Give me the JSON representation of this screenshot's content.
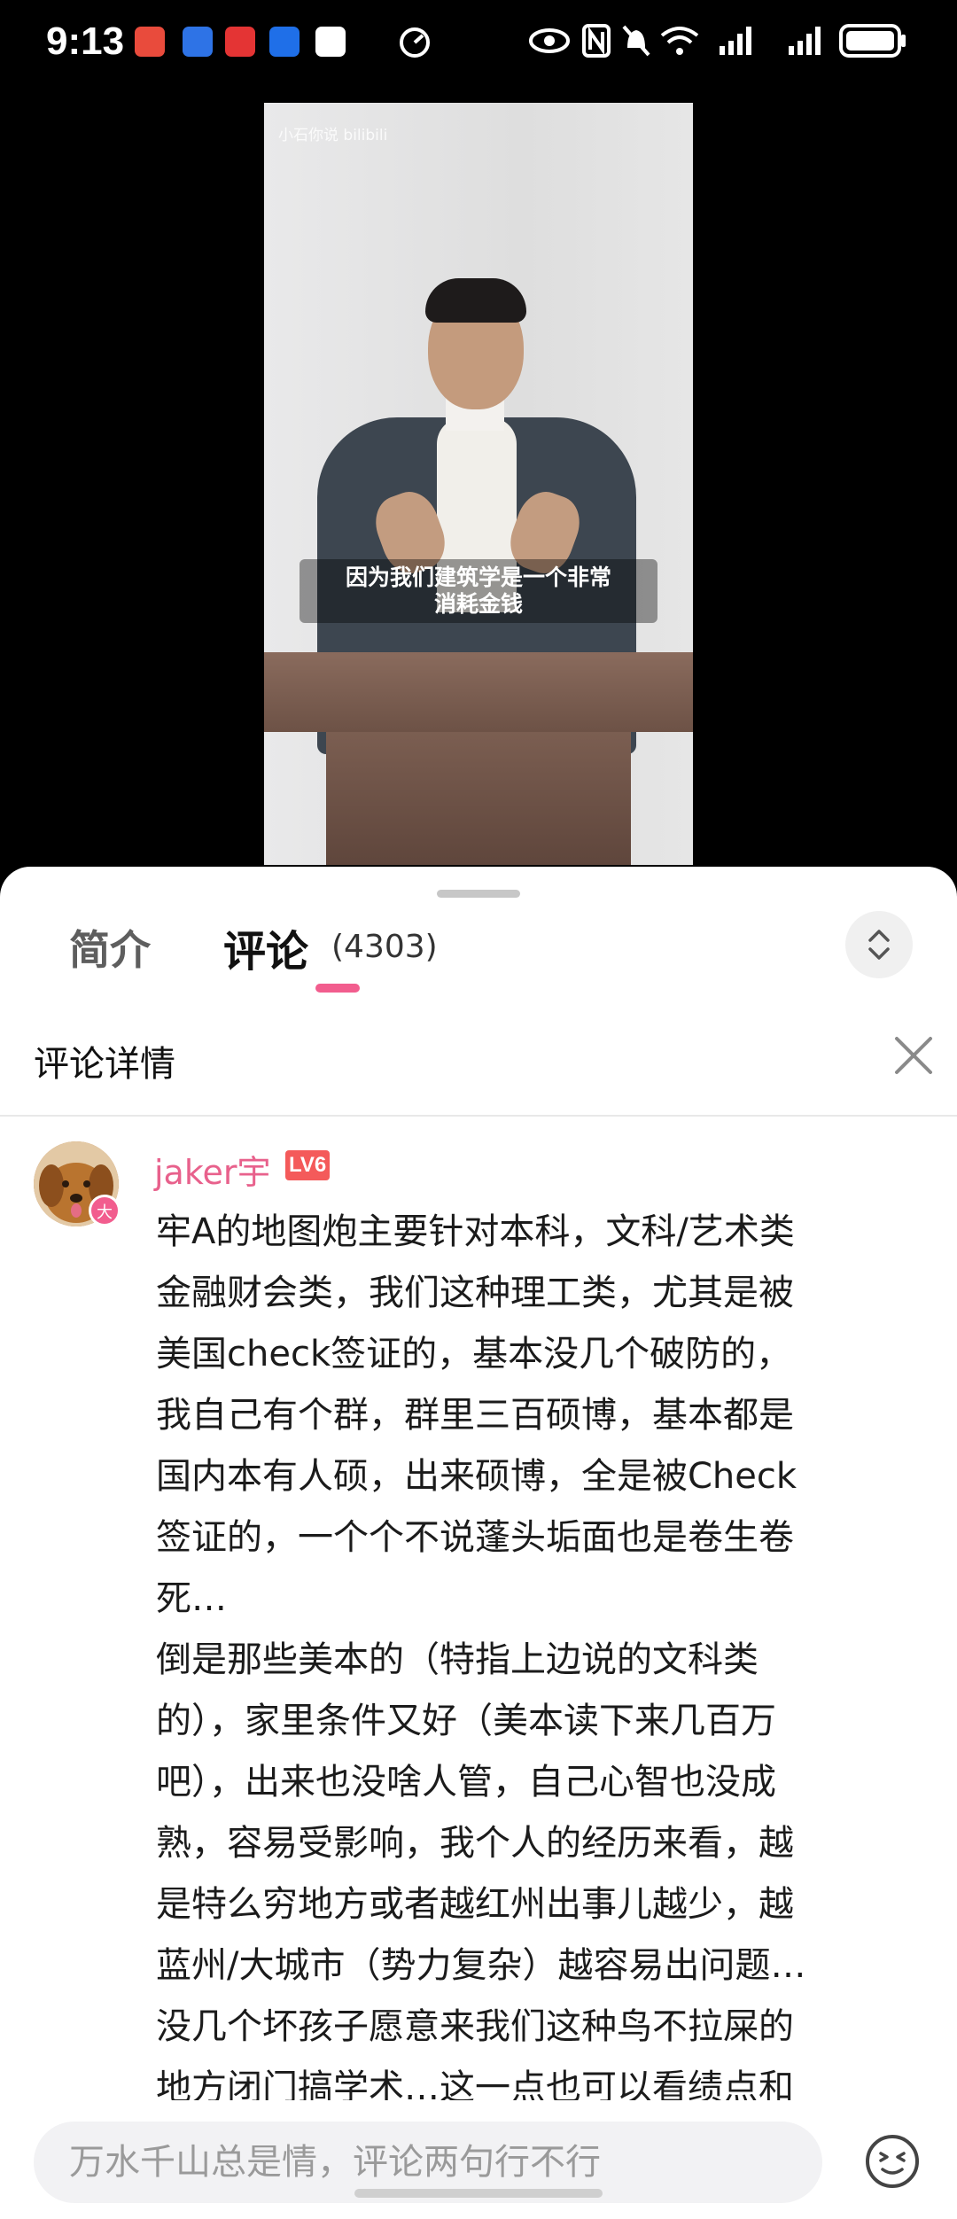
{
  "status_bar": {
    "time": "9:13"
  },
  "video": {
    "watermark": "小石你说 bilibili",
    "subtitle": "因为我们建筑学是一个非常\n消耗金钱"
  },
  "tabs": {
    "intro": "简介",
    "comments": "评论",
    "comment_count": "(4303)"
  },
  "panel": {
    "title": "评论详情"
  },
  "comment": {
    "username": "jaker宇",
    "level": "LV6",
    "avatar_badge": "大",
    "text": "牢A的地图炮主要针对本科，文科/艺术类\n金融财会类，我们这种理工类，尤其是被\n美国check签证的，基本没几个破防的，\n我自己有个群，群里三百硕博，基本都是\n国内本有人硕，出来硕博，全是被Check\n签证的，一个个不说蓬头垢面也是卷生卷\n死…\n倒是那些美本的（特指上边说的文科类\n的），家里条件又好（美本读下来几百万\n吧），出来也没啥人管，自己心智也没成\n熟，容易受影响，我个人的经历来看，越\n是特么穷地方或者越红州出事儿越少，越\n蓝州/大城市（势力复杂）越容易出问题…\n没几个坏孩子愿意来我们这种鸟不拉屎的\n地方闭门搞学术…这一点也可以看绩点和"
  },
  "input": {
    "placeholder": "万水千山总是情，评论两句行不行"
  },
  "colors": {
    "accent": "#f25d8e",
    "username": "#e8618c",
    "level_badge": "#f45a5a"
  }
}
